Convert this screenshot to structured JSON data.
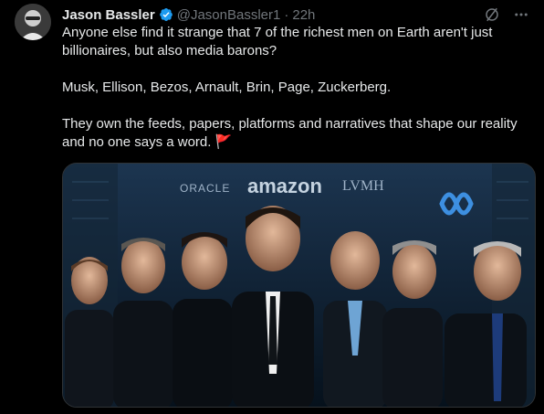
{
  "author": {
    "display_name": "Jason Bassler",
    "handle": "@JasonBassler1",
    "time": "22h"
  },
  "tweet": {
    "line1": "Anyone else find it strange that 7 of the richest men on Earth aren't just billionaires, but also media barons?",
    "line2": "Musk, Ellison, Bezos, Arnault, Brin, Page, Zuckerberg.",
    "line3": "They own the feeds, papers, platforms and narratives that shape our reality and no one says a word. 🚩"
  },
  "media": {
    "logos": {
      "oracle": "ORACLE",
      "amazon": "amazon",
      "lvmh": "LVMH"
    }
  },
  "icons": [
    "avatar",
    "verified-badge-icon",
    "grok-icon",
    "more-icon",
    "meta-logo-icon"
  ],
  "colors": {
    "verified": "#1d9bf0",
    "muted": "#71767b",
    "text": "#e7e9ea",
    "background": "#000000"
  }
}
